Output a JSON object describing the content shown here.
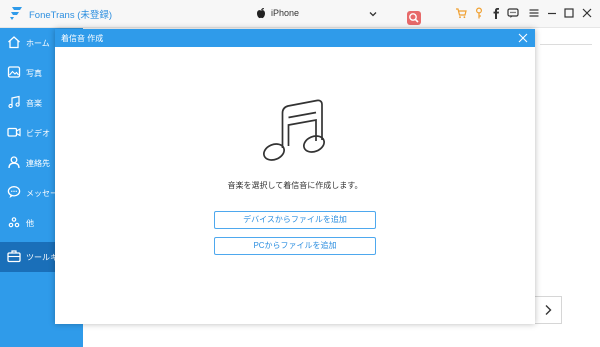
{
  "app": {
    "title": "FoneTrans (未登録)",
    "logo_icon": "fonetrans-logo-icon",
    "brand_color": "#2f9bea"
  },
  "device": {
    "name": "iPhone",
    "icon": "apple-icon"
  },
  "toolbar": {
    "icons": [
      "search-icon",
      "cart-icon",
      "key-icon",
      "facebook-icon",
      "chat-icon",
      "menu-icon",
      "minimize-icon",
      "maximize-icon",
      "close-icon"
    ]
  },
  "sidebar": {
    "items": [
      {
        "label": "ホーム",
        "icon": "home-icon"
      },
      {
        "label": "写真",
        "icon": "photo-icon"
      },
      {
        "label": "音楽",
        "icon": "music-icon"
      },
      {
        "label": "ビデオ",
        "icon": "video-icon"
      },
      {
        "label": "連絡先",
        "icon": "contacts-icon"
      },
      {
        "label": "メッセージ",
        "icon": "message-icon"
      },
      {
        "label": "他",
        "icon": "other-icon"
      },
      {
        "label": "ツールキット",
        "icon": "toolkit-icon"
      }
    ],
    "active_index": 7
  },
  "dialog": {
    "title": "着信音 作成",
    "message": "音楽を選択して着信音に作成します。",
    "buttons": {
      "add_from_device": "デバイスからファイルを追加",
      "add_from_pc": "PCからファイルを追加"
    }
  }
}
